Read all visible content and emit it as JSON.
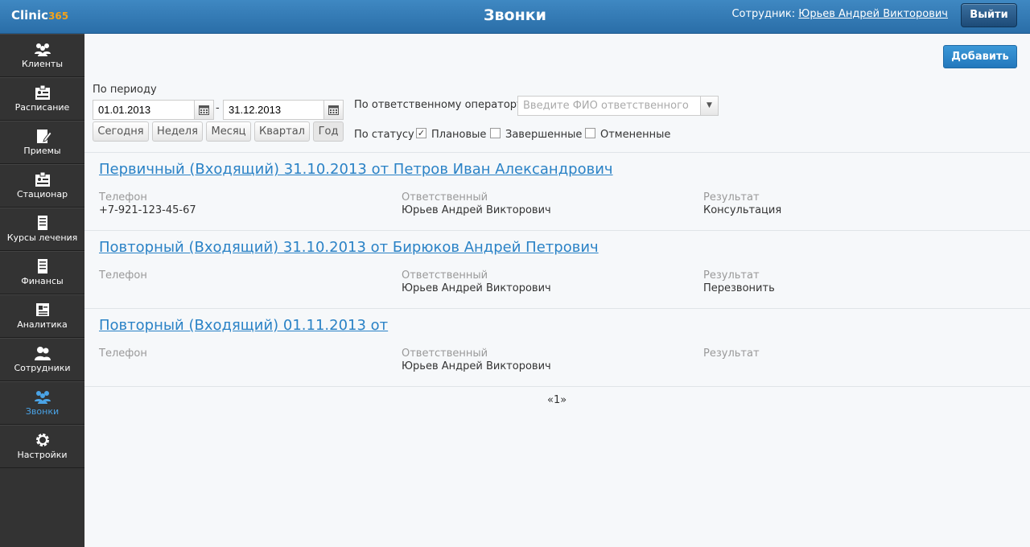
{
  "header": {
    "logo_main": "Clinic",
    "logo_num": "365",
    "title": "Звонки",
    "employee_label": "Сотрудник:",
    "employee_name": "Юрьев Андрей Викторович",
    "logout": "Выйти"
  },
  "sidebar": {
    "items": [
      {
        "label": "Клиенты",
        "icon": "users-icon"
      },
      {
        "label": "Расписание",
        "icon": "schedule-icon"
      },
      {
        "label": "Приемы",
        "icon": "appointments-icon"
      },
      {
        "label": "Стационар",
        "icon": "hospital-icon"
      },
      {
        "label": "Курсы лечения",
        "icon": "treatment-icon"
      },
      {
        "label": "Финансы",
        "icon": "finance-icon"
      },
      {
        "label": "Аналитика",
        "icon": "analytics-icon"
      },
      {
        "label": "Сотрудники",
        "icon": "staff-icon"
      },
      {
        "label": "Звонки",
        "icon": "calls-icon",
        "active": true
      },
      {
        "label": "Настройки",
        "icon": "gear-icon"
      }
    ]
  },
  "toolbar": {
    "add": "Добавить"
  },
  "filters": {
    "period_label": "По периоду",
    "date_from": "01.01.2013",
    "date_to": "31.12.2013",
    "dash": "-",
    "quick": [
      "Сегодня",
      "Неделя",
      "Месяц",
      "Квартал",
      "Год"
    ],
    "operator_label": "По ответственному оператору",
    "operator_placeholder": "Введите ФИО ответственного",
    "status_label": "По статусу",
    "statuses": [
      {
        "label": "Плановые",
        "checked": true
      },
      {
        "label": "Завершенные",
        "checked": false
      },
      {
        "label": "Отмененные",
        "checked": false
      }
    ]
  },
  "labels": {
    "phone": "Телефон",
    "responsible": "Ответственный",
    "result": "Результат"
  },
  "calls": [
    {
      "title": "Первичный (Входящий) 31.10.2013 от Петров Иван Александрович",
      "phone": "+7-921-123-45-67",
      "responsible": "Юрьев Андрей Викторович",
      "result": "Консультация"
    },
    {
      "title": "Повторный (Входящий) 31.10.2013 от Бирюков Андрей Петрович",
      "phone": "",
      "responsible": "Юрьев Андрей Викторович",
      "result": "Перезвонить"
    },
    {
      "title": "Повторный (Входящий) 01.11.2013 от",
      "phone": "",
      "responsible": "Юрьев Андрей Викторович",
      "result": ""
    }
  ],
  "pagination": "«1»"
}
